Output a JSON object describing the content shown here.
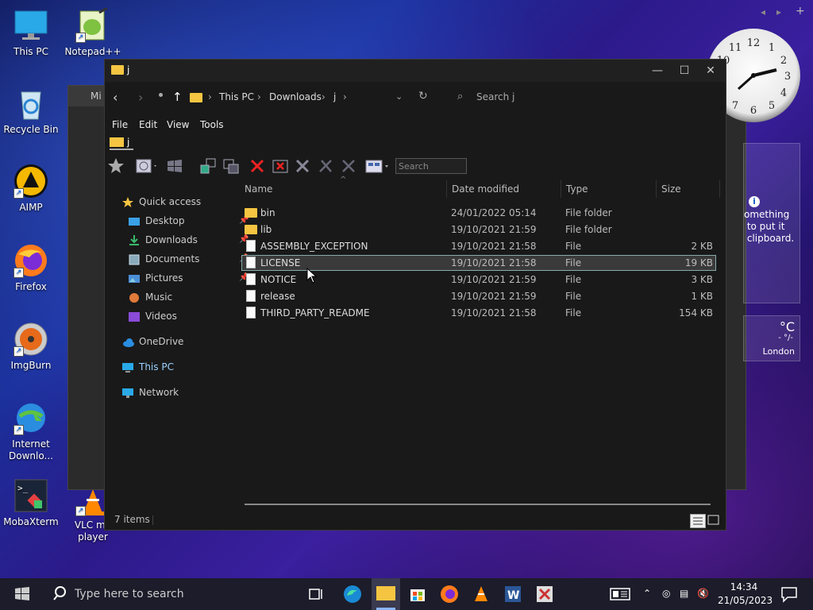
{
  "desktop": {
    "icons": [
      {
        "label": "This PC"
      },
      {
        "label": "Notepad++"
      },
      {
        "label": "Recycle Bin"
      },
      {
        "label": "AIMP"
      },
      {
        "label": "Firefox"
      },
      {
        "label": "ImgBurn"
      },
      {
        "label": "Internet Downlo..."
      },
      {
        "label": "MobaXterm"
      },
      {
        "label": "VLC me player"
      }
    ],
    "bg_window_title": "Mi",
    "gadget_text": "omething\n to put it\n clipboard.",
    "weather_unit": "°C",
    "weather_sub": "- °/-",
    "weather_city": "London"
  },
  "window": {
    "title": "j",
    "address": {
      "crumbs": [
        "This PC",
        "Downloads",
        "j"
      ],
      "search_placeholder": "Search j"
    },
    "menu": [
      "File",
      "Edit",
      "View",
      "Tools"
    ],
    "folder_tab": "j",
    "toolbar_search_placeholder": "Search",
    "nav": {
      "quick_access": "Quick access",
      "items": [
        {
          "label": "Desktop",
          "pinned": true
        },
        {
          "label": "Downloads",
          "pinned": true
        },
        {
          "label": "Documents",
          "pinned": true
        },
        {
          "label": "Pictures",
          "pinned": true
        },
        {
          "label": "Music",
          "pinned": false
        },
        {
          "label": "Videos",
          "pinned": false
        }
      ],
      "onedrive": "OneDrive",
      "thispc": "This PC",
      "network": "Network"
    },
    "columns": {
      "name": "Name",
      "date": "Date modified",
      "type": "Type",
      "size": "Size"
    },
    "files": [
      {
        "name": "bin",
        "date": "24/01/2022 05:14",
        "type": "File folder",
        "size": "",
        "folder": true
      },
      {
        "name": "lib",
        "date": "19/10/2021 21:59",
        "type": "File folder",
        "size": "",
        "folder": true
      },
      {
        "name": "ASSEMBLY_EXCEPTION",
        "date": "19/10/2021 21:58",
        "type": "File",
        "size": "2 KB",
        "folder": false
      },
      {
        "name": "LICENSE",
        "date": "19/10/2021 21:58",
        "type": "File",
        "size": "19 KB",
        "folder": false
      },
      {
        "name": "NOTICE",
        "date": "19/10/2021 21:59",
        "type": "File",
        "size": "3 KB",
        "folder": false
      },
      {
        "name": "release",
        "date": "19/10/2021 21:59",
        "type": "File",
        "size": "1 KB",
        "folder": false
      },
      {
        "name": "THIRD_PARTY_README",
        "date": "19/10/2021 21:58",
        "type": "File",
        "size": "154 KB",
        "folder": false
      }
    ],
    "status": "7 items"
  },
  "taskbar": {
    "search_placeholder": "Type here to search",
    "time": "14:34",
    "date": "21/05/2023"
  }
}
